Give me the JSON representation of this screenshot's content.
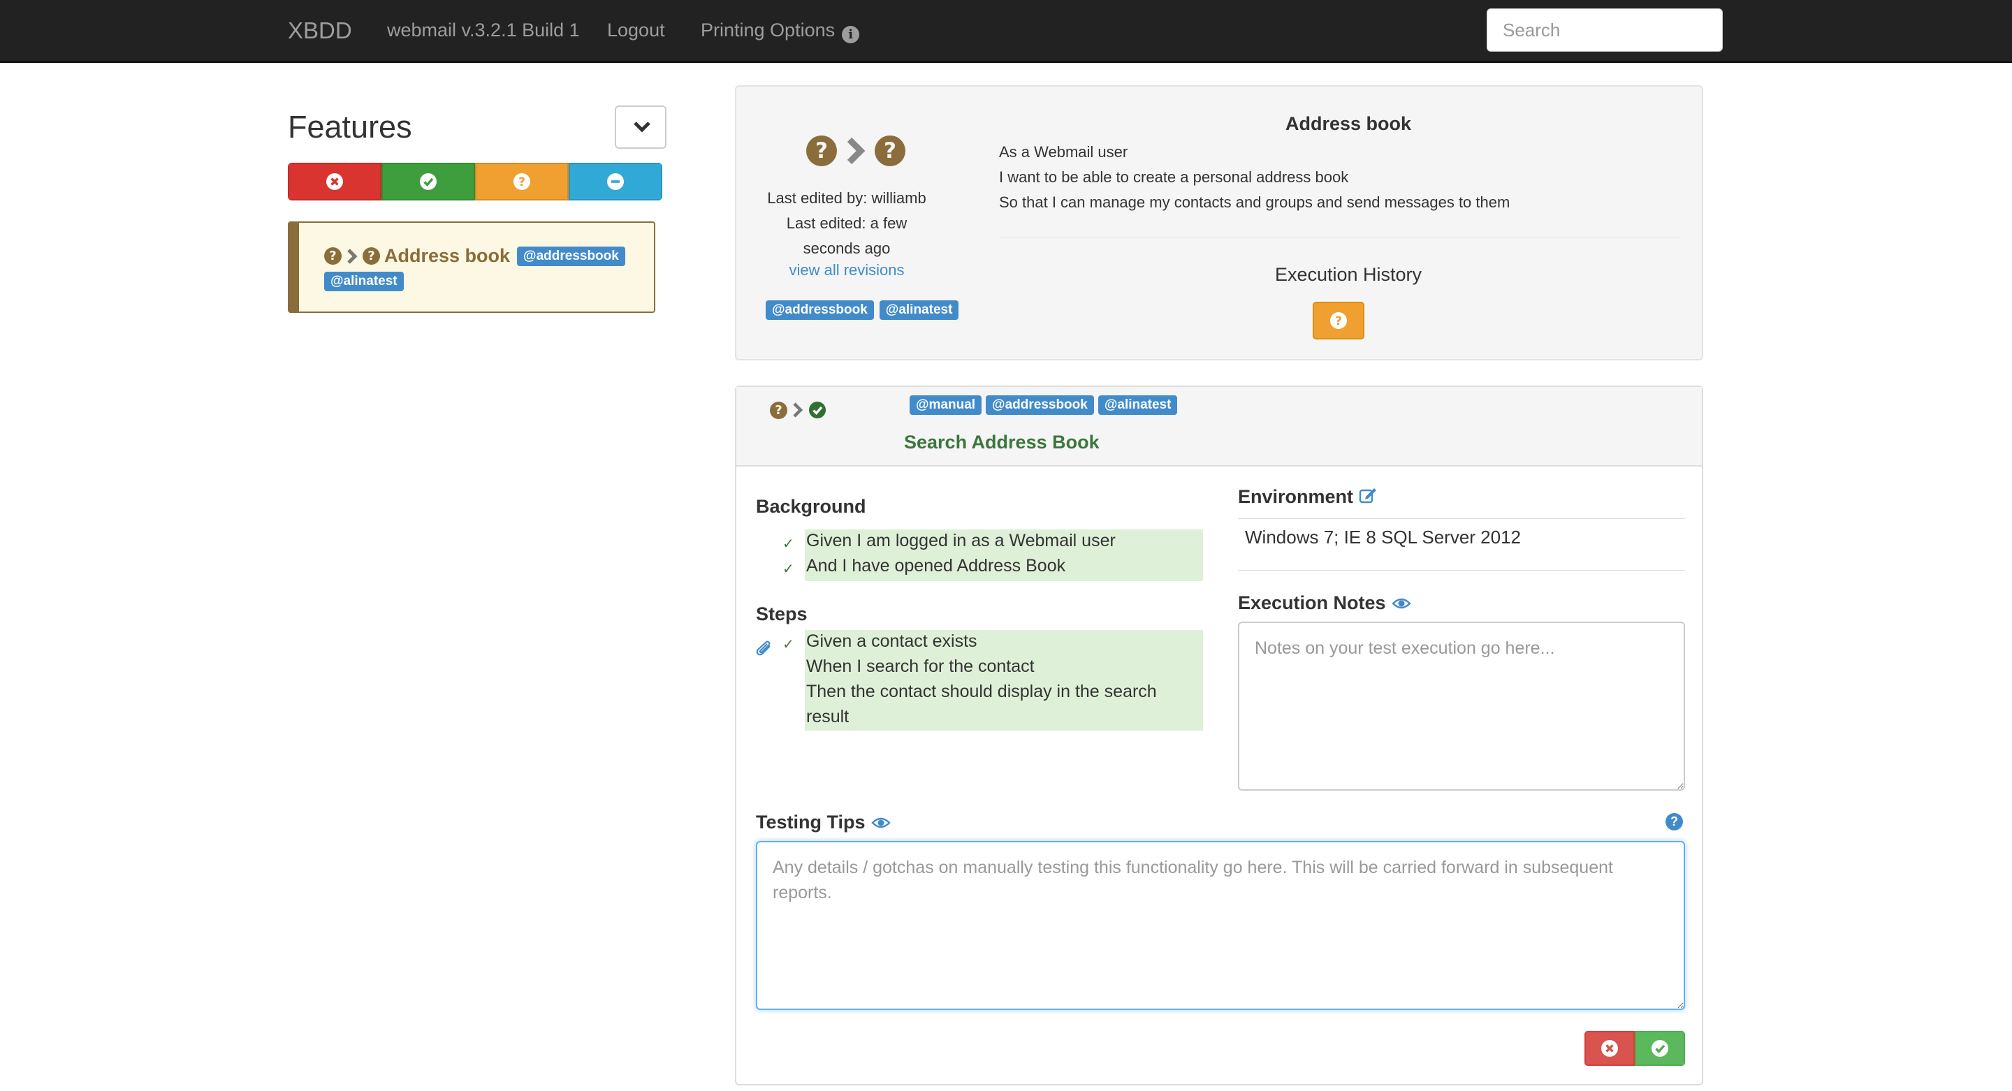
{
  "navbar": {
    "brand": "XBDD",
    "build": "webmail v.3.2.1 Build 1",
    "logout": "Logout",
    "printing_options": "Printing Options",
    "search_placeholder": "Search"
  },
  "sidebar": {
    "title": "Features",
    "feature_card": {
      "title": "Address book",
      "tags": [
        "@addressbook",
        "@alinatest"
      ]
    }
  },
  "feature": {
    "title": "Address book",
    "narrative": [
      "As a Webmail user",
      "I want to be able to create a personal address book",
      "So that I can manage my contacts and groups and send messages to them"
    ],
    "last_edited_by": "Last edited by: williamb",
    "last_edited": "Last edited: a few seconds ago",
    "view_revisions": "view all revisions",
    "tags": [
      "@addressbook",
      "@alinatest"
    ],
    "execution_history_title": "Execution History"
  },
  "scenario": {
    "tags": [
      "@manual",
      "@addressbook",
      "@alinatest"
    ],
    "title": "Search Address Book",
    "background_label": "Background",
    "background_steps": [
      "Given I am logged in as a Webmail user",
      "And I have opened Address Book"
    ],
    "steps_label": "Steps",
    "steps": [
      "Given a contact exists",
      "When I search for the contact",
      "Then the contact should display in the search",
      "result"
    ],
    "environment_label": "Environment",
    "environment_value": "Windows 7; IE 8 SQL Server 2012",
    "execution_notes_label": "Execution Notes",
    "execution_notes_placeholder": "Notes on your test execution go here...",
    "testing_tips_label": "Testing Tips",
    "testing_tips_placeholder": "Any details / gotchas on manually testing this functionality go here. This will be carried forward in subsequent reports."
  },
  "colors": {
    "failed": "#d9342f",
    "passed": "#3e9e3e",
    "unknown": "#f0a030",
    "skipped": "#31a9d6",
    "link": "#428bca",
    "step_bg": "#dff0d8"
  },
  "icons": {
    "status_failed": "times-circle-icon",
    "status_passed": "check-circle-icon",
    "status_unknown": "question-circle-icon",
    "status_skipped": "minus-circle-icon",
    "attachment": "paperclip-icon",
    "edit": "edit-icon",
    "visibility": "eye-icon",
    "help": "question-circle-icon"
  }
}
